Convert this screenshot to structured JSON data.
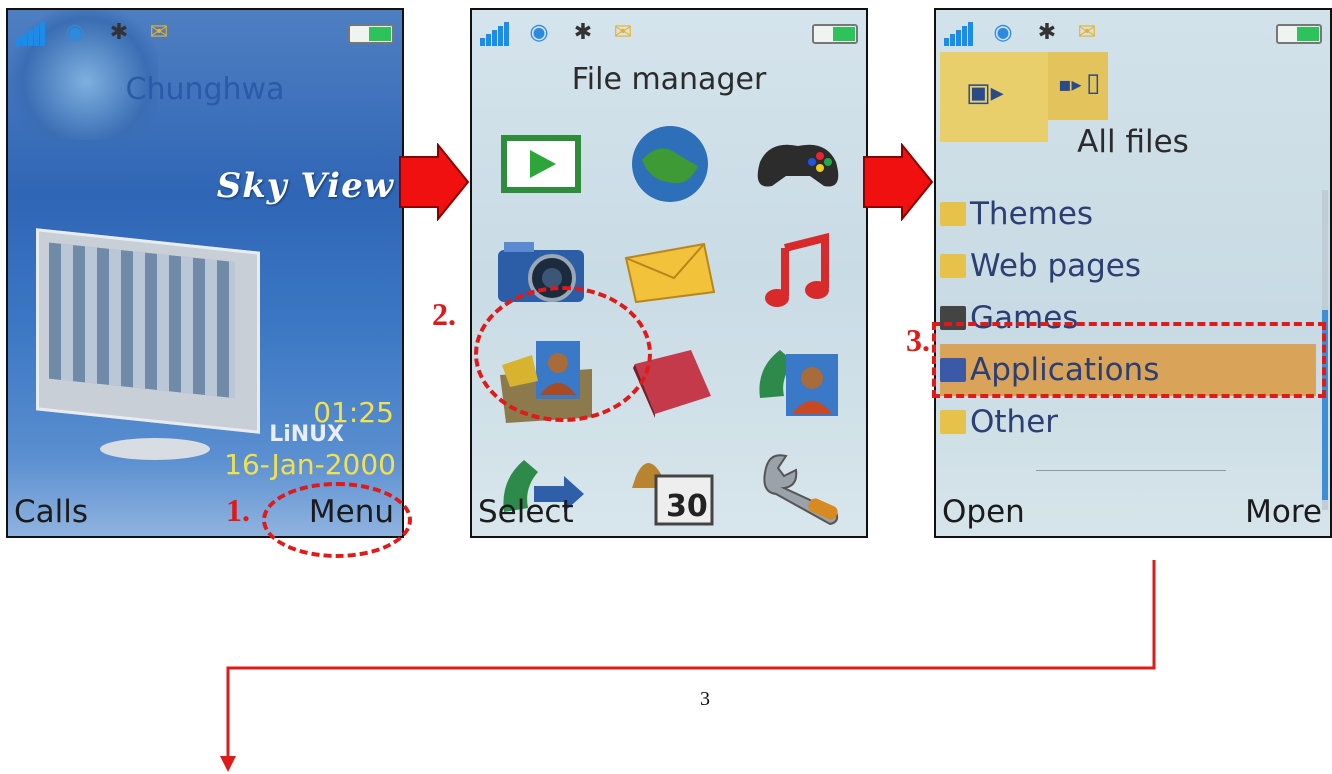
{
  "screen1": {
    "carrier": "Chunghwa",
    "logo_text": "Sky View",
    "time": "01:25",
    "os": "LiNUX",
    "date": "16-Jan-2000",
    "softkey_left": "Calls",
    "softkey_right": "Menu",
    "step_label": "1."
  },
  "screen2": {
    "title": "File manager",
    "softkey_left": "Select",
    "step_label": "2.",
    "icons": [
      "media-player-icon",
      "internet-globe-icon",
      "games-controller-icon",
      "camera-icon",
      "messaging-envelope-icon",
      "music-note-icon",
      "file-manager-folder-icon",
      "phonebook-icon",
      "contacts-phone-icon",
      "call-log-icon",
      "organizer-calendar-icon",
      "settings-wrench-icon"
    ]
  },
  "screen3": {
    "title": "All files",
    "files": [
      "Themes",
      "Web pages",
      "Games",
      "Applications",
      "Other"
    ],
    "selected_index": 3,
    "softkey_left": "Open",
    "softkey_right": "More",
    "step_label": "3."
  },
  "page_number": "3",
  "colors": {
    "annotation_red": "#e01919",
    "selection": "#d9a45a",
    "accent_blue": "#1e8be6"
  }
}
